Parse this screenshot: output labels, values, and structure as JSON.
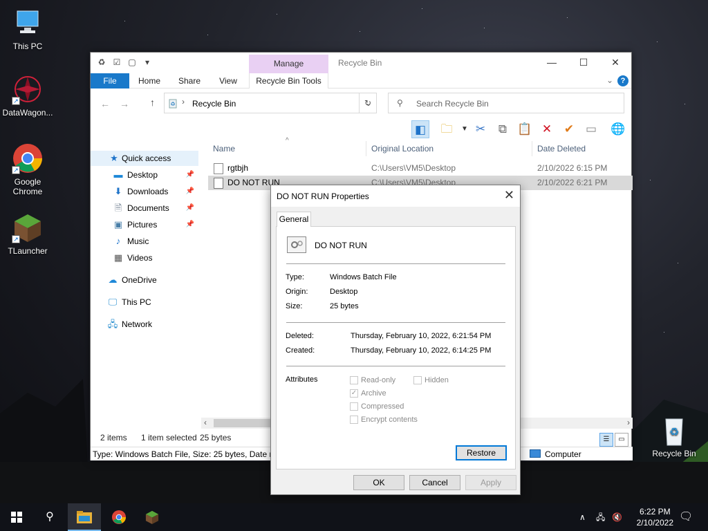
{
  "desktop": {
    "icons": [
      {
        "label": "This PC"
      },
      {
        "label": "DataWagon..."
      },
      {
        "label": "Google Chrome"
      },
      {
        "label": "TLauncher"
      }
    ],
    "recycle_bin_label": "Recycle Bin"
  },
  "explorer": {
    "window_title": "Recycle Bin",
    "manage_label": "Manage",
    "ribbon_tabs": [
      "File",
      "Home",
      "Share",
      "View",
      "Recycle Bin Tools"
    ],
    "address_text": "Recycle Bin",
    "search_placeholder": "Search Recycle Bin",
    "nav": {
      "quick_access": "Quick access",
      "items": [
        "Desktop",
        "Downloads",
        "Documents",
        "Pictures",
        "Music",
        "Videos"
      ],
      "onedrive": "OneDrive",
      "this_pc": "This PC",
      "network": "Network"
    },
    "columns": [
      "Name",
      "Original Location",
      "Date Deleted"
    ],
    "rows": [
      {
        "name": "rgtbjh",
        "location": "C:\\Users\\VM5\\Desktop",
        "date": "2/10/2022 6:15 PM"
      },
      {
        "name": "DO NOT RUN",
        "location": "C:\\Users\\VM5\\Desktop",
        "date": "2/10/2022 6:21 PM"
      }
    ],
    "status": {
      "items": "2 items",
      "selected": "1 item selected",
      "size": "25 bytes"
    },
    "infobar_text": "Type: Windows Batch File, Size: 25 bytes, Date modified: 2/10/2022 6:14 PM",
    "infobar_location": "Computer"
  },
  "dialog": {
    "title": "DO NOT RUN Properties",
    "tab": "General",
    "file_name": "DO NOT RUN",
    "type_label": "Type:",
    "type_value": "Windows Batch File",
    "origin_label": "Origin:",
    "origin_value": "Desktop",
    "size_label": "Size:",
    "size_value": "25 bytes",
    "deleted_label": "Deleted:",
    "deleted_value": "Thursday, February 10, 2022, 6:21:54 PM",
    "created_label": "Created:",
    "created_value": "Thursday, February 10, 2022, 6:14:25 PM",
    "attributes_label": "Attributes",
    "attrs": {
      "readonly": "Read-only",
      "hidden": "Hidden",
      "archive": "Archive",
      "compressed": "Compressed",
      "encrypt": "Encrypt contents"
    },
    "restore": "Restore",
    "ok": "OK",
    "cancel": "Cancel",
    "apply": "Apply"
  },
  "taskbar": {
    "time": "6:22 PM",
    "date": "2/10/2022"
  }
}
